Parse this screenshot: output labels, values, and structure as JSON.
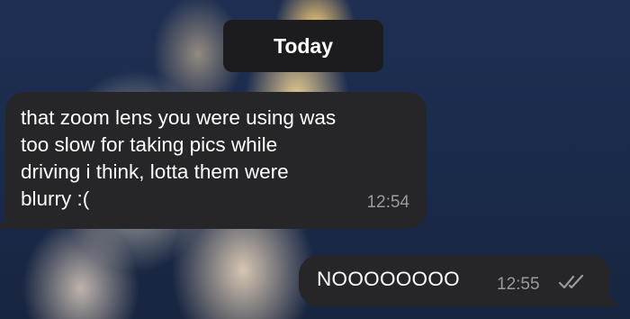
{
  "date_separator": "Today",
  "messages": [
    {
      "direction": "incoming",
      "lines": [
        "that zoom lens you were using was",
        "too slow for taking pics while",
        "driving i think, lotta them were",
        "blurry :("
      ],
      "time": "12:54"
    },
    {
      "direction": "outgoing",
      "text": "NOOOOOOOO",
      "time": "12:55",
      "status_icon": "double-check-icon"
    }
  ],
  "colors": {
    "bubble": "#262628",
    "date_pill": "#1c1c1e",
    "timestamp": "#9a9a9e",
    "text": "#ffffff"
  }
}
